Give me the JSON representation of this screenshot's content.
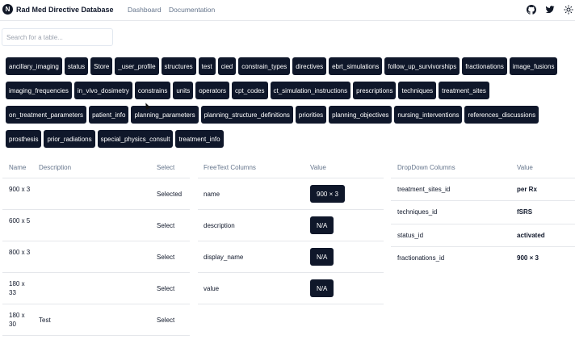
{
  "header": {
    "logo_letter": "N",
    "title": "Rad Med Directive Database",
    "nav": [
      "Dashboard",
      "Documentation"
    ],
    "icons": [
      "github-icon",
      "twitter-icon",
      "sun-icon"
    ]
  },
  "search": {
    "placeholder": "Search for a table...",
    "value": ""
  },
  "tables": [
    "ancillary_imaging",
    "status",
    "Store",
    "_user_profile",
    "structures",
    "test",
    "cied",
    "constrain_types",
    "directives",
    "ebrt_simulations",
    "follow_up_survivorships",
    "fractionations",
    "image_fusions",
    "imaging_frequencies",
    "in_vivo_dosimetry",
    "constrains",
    "units",
    "operators",
    "cpt_codes",
    "ct_simulation_instructions",
    "prescriptions",
    "techniques",
    "treatment_sites",
    "on_treatment_parameters",
    "patient_info",
    "planning_parameters",
    "planning_structure_definitions",
    "priorities",
    "planning_objectives",
    "nursing_interventions",
    "references_discussions",
    "prosthesis",
    "prior_radiations",
    "special_physics_consult",
    "treatment_info"
  ],
  "records": {
    "headers": {
      "name": "Name",
      "description": "Description",
      "select": "Select"
    },
    "rows": [
      {
        "name": "900 x 3",
        "description": "",
        "select": "Selected"
      },
      {
        "name": "600 x 5",
        "description": "",
        "select": "Select"
      },
      {
        "name": "800 x 3",
        "description": "",
        "select": "Select"
      },
      {
        "name": "180 x 33",
        "description": "",
        "select": "Select"
      },
      {
        "name": "180 x 30",
        "description": "Test",
        "select": "Select"
      }
    ]
  },
  "freetext": {
    "headers": {
      "column": "FreeText Columns",
      "value": "Value"
    },
    "rows": [
      {
        "column": "name",
        "value": "900 × 3"
      },
      {
        "column": "description",
        "value": "N/A"
      },
      {
        "column": "display_name",
        "value": "N/A"
      },
      {
        "column": "value",
        "value": "N/A"
      }
    ]
  },
  "dropdown": {
    "headers": {
      "column": "DropDown Columns",
      "value": "Value"
    },
    "rows": [
      {
        "column": "treatment_sites_id",
        "value": "per Rx"
      },
      {
        "column": "techniques_id",
        "value": "fSRS"
      },
      {
        "column": "status_id",
        "value": "activated"
      },
      {
        "column": "fractionations_id",
        "value": "900 × 3"
      }
    ]
  }
}
